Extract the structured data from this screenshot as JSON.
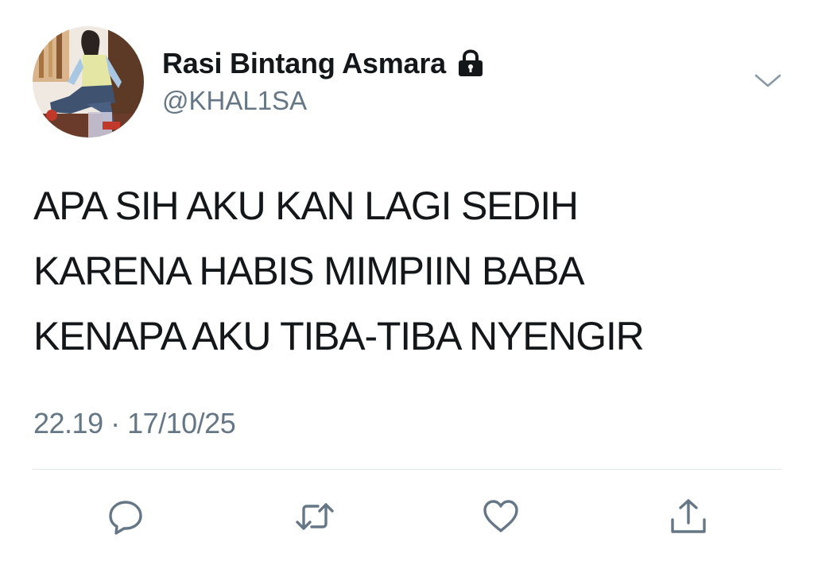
{
  "tweet": {
    "author": {
      "display_name": "Rasi Bintang Asmara",
      "handle": "@KHAL1SA",
      "protected": true,
      "avatar_icon": "profile-photo",
      "lock_icon": "lock-icon"
    },
    "menu_icon": "chevron-down-icon",
    "text_lines": [
      "APA SIH AKU KAN LAGI SEDIH",
      "KARENA HABIS MIMPIIN BABA",
      "KENAPA AKU TIBA-TIBA NYENGIR"
    ],
    "timestamp": "22.19 · 17/10/25"
  },
  "actions": [
    {
      "name": "reply",
      "icon": "reply-icon"
    },
    {
      "name": "retweet",
      "icon": "retweet-icon"
    },
    {
      "name": "like",
      "icon": "heart-icon"
    },
    {
      "name": "share",
      "icon": "share-icon"
    }
  ],
  "colors": {
    "text": "#14171a",
    "secondary": "#657786",
    "divider": "#e1e8ed"
  }
}
